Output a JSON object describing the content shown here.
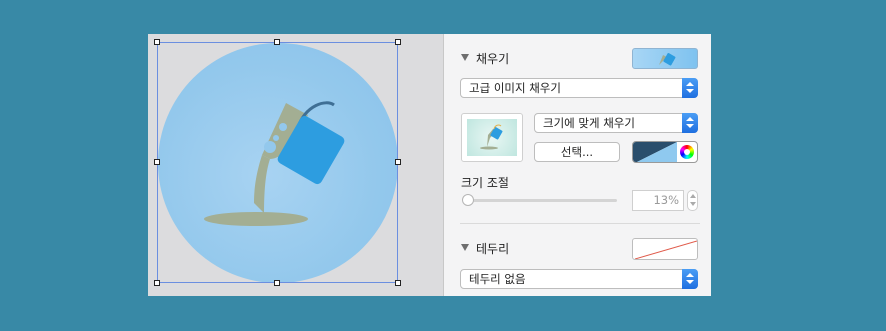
{
  "fill": {
    "title": "채우기",
    "type_value": "고급 이미지 채우기",
    "scale_mode_value": "크기에 맞게 채우기",
    "choose_label": "선택...",
    "scale_label": "크기 조절",
    "scale_value": "13%",
    "swatch_color": "#8fc9ef",
    "tint_color": "#2a4e6c"
  },
  "border": {
    "title": "테두리",
    "type_value": "테두리 없음"
  },
  "shape": {
    "fill_color": "#93c8ec",
    "bucket_color": "#2d9de0",
    "paint_color": "#a3ae93"
  }
}
